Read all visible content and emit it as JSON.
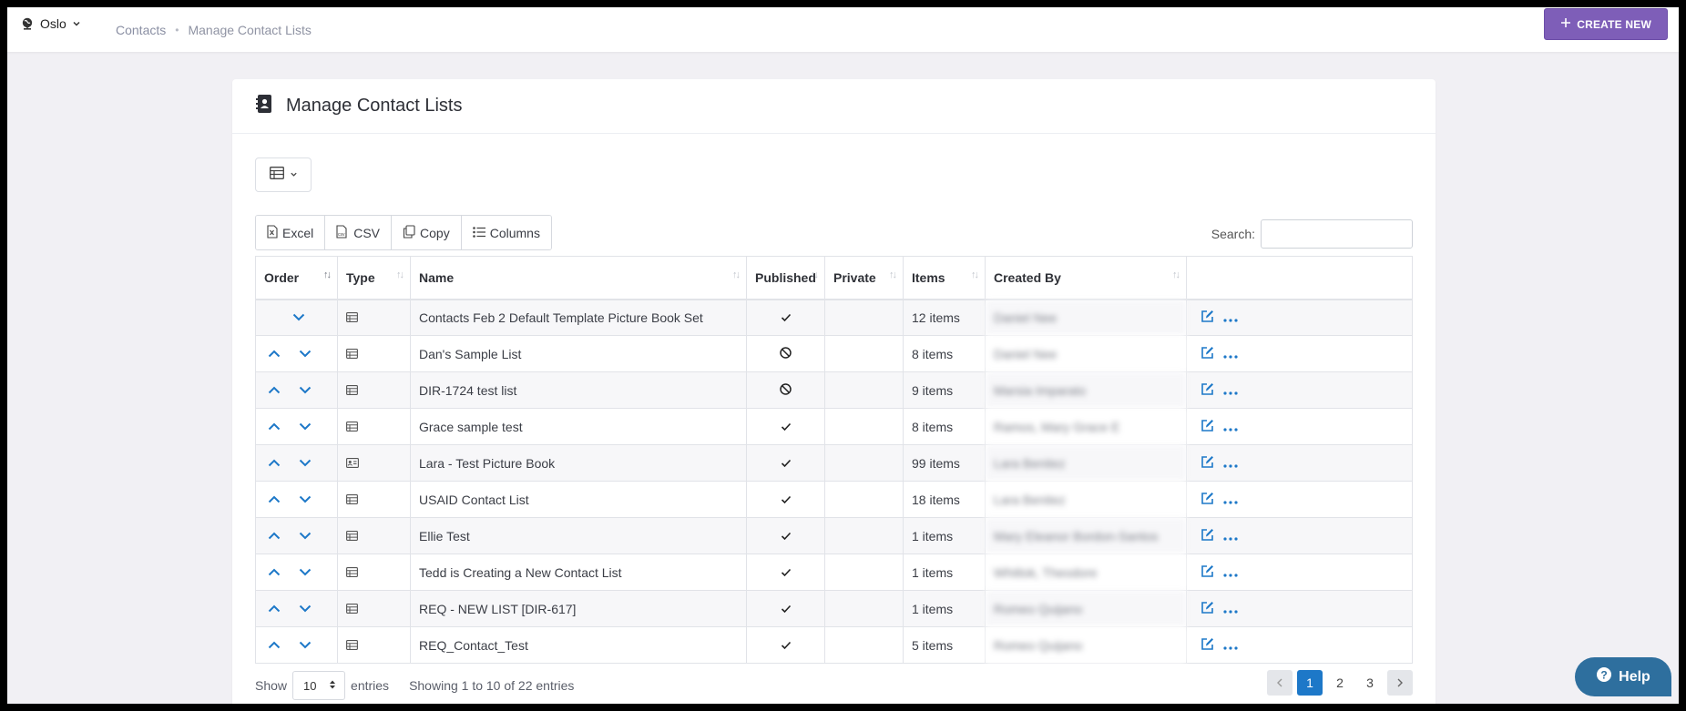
{
  "header": {
    "site_name": "Oslo",
    "breadcrumb": [
      "Contacts",
      "Manage Contact Lists"
    ],
    "create_button": "CREATE NEW"
  },
  "page": {
    "title": "Manage Contact Lists"
  },
  "toolbar": {
    "export_buttons": [
      "Excel",
      "CSV",
      "Copy",
      "Columns"
    ],
    "search_label": "Search:",
    "search_value": ""
  },
  "table": {
    "columns": [
      "Order",
      "Type",
      "Name",
      "Published",
      "Private",
      "Items",
      "Created By"
    ],
    "rows": [
      {
        "name": "Contacts Feb 2 Default Template Picture Book Set",
        "type": "list",
        "published": "check",
        "items": "12 items",
        "created_by": "Daniel Nee",
        "first": true
      },
      {
        "name": "Dan's Sample List",
        "type": "list",
        "published": "ban",
        "items": "8 items",
        "created_by": "Daniel Nee"
      },
      {
        "name": "DIR-1724 test list",
        "type": "list",
        "published": "ban",
        "items": "9 items",
        "created_by": "Marsia Imparato"
      },
      {
        "name": "Grace sample test",
        "type": "list",
        "published": "check",
        "items": "8 items",
        "created_by": "Ramos, Mary Grace E"
      },
      {
        "name": "Lara - Test Picture Book",
        "type": "card",
        "published": "check",
        "items": "99 items",
        "created_by": "Lara Benitez"
      },
      {
        "name": "USAID Contact List",
        "type": "list",
        "published": "check",
        "items": "18 items",
        "created_by": "Lara Benitez"
      },
      {
        "name": "Ellie Test",
        "type": "list",
        "published": "check",
        "items": "1 items",
        "created_by": "Mary Eleanor Bordon-Santos"
      },
      {
        "name": "Tedd is Creating a New Contact List",
        "type": "list",
        "published": "check",
        "items": "1 items",
        "created_by": "Whitlok, Theodore"
      },
      {
        "name": "REQ - NEW LIST [DIR-617]",
        "type": "list",
        "published": "check",
        "items": "1 items",
        "created_by": "Romeo Quijano"
      },
      {
        "name": "REQ_Contact_Test",
        "type": "list",
        "published": "check",
        "items": "5 items",
        "created_by": "Romeo Quijano"
      }
    ]
  },
  "footer": {
    "show_label": "Show",
    "page_length": "10",
    "entries_label": "entries",
    "info": "Showing 1 to 10 of 22 entries",
    "pages": [
      "1",
      "2",
      "3"
    ],
    "current_page": "1"
  },
  "help": {
    "label": "Help"
  },
  "colors": {
    "accent": "#7e5eb8",
    "link": "#1d78c8",
    "help": "#2e6f9e"
  }
}
